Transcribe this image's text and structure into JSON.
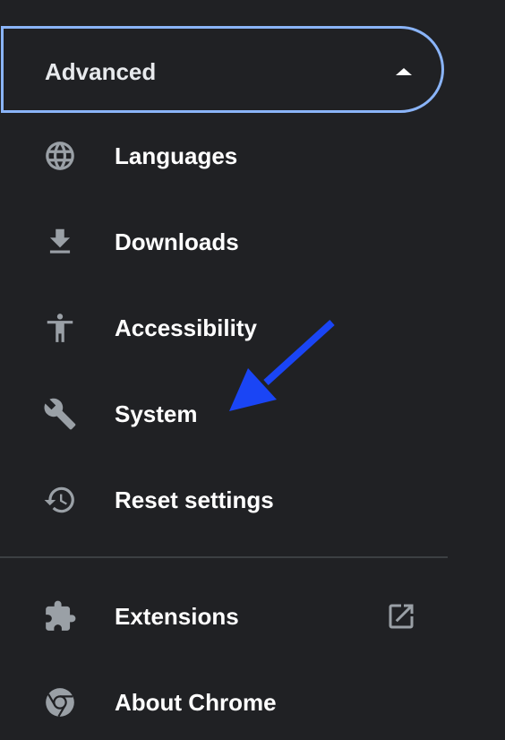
{
  "advanced": {
    "label": "Advanced",
    "expanded": true,
    "icon": "caret-up-icon"
  },
  "menu_items": [
    {
      "label": "Languages",
      "icon": "globe-icon"
    },
    {
      "label": "Downloads",
      "icon": "download-icon"
    },
    {
      "label": "Accessibility",
      "icon": "accessibility-icon"
    },
    {
      "label": "System",
      "icon": "wrench-icon"
    },
    {
      "label": "Reset settings",
      "icon": "history-icon"
    }
  ],
  "bottom_items": [
    {
      "label": "Extensions",
      "icon": "puzzle-icon",
      "trailing_icon": "open-in-new-icon"
    },
    {
      "label": "About Chrome",
      "icon": "chrome-icon"
    }
  ],
  "annotation": {
    "type": "arrow",
    "color": "#1a45f5",
    "points_to": "System"
  },
  "colors": {
    "background": "#202124",
    "accent_border": "#8ab4f8",
    "icon": "#9aa0a6",
    "text": "#ffffff"
  }
}
